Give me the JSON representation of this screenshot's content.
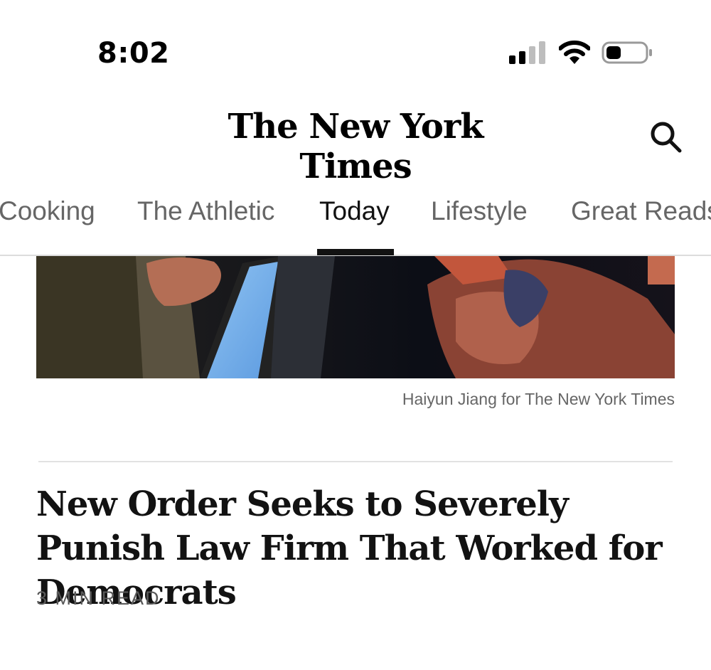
{
  "status_bar": {
    "time": "8:02"
  },
  "masthead": {
    "logo_text": "The New York Times"
  },
  "nav": {
    "tabs": [
      {
        "label": "Cooking",
        "active": false
      },
      {
        "label": "The Athletic",
        "active": false
      },
      {
        "label": "Today",
        "active": true
      },
      {
        "label": "Lifestyle",
        "active": false
      },
      {
        "label": "Great Reads",
        "active": false
      }
    ]
  },
  "article": {
    "photo_credit": "Haiyun Jiang for The New York Times",
    "headline": "New Order Seeks to Severely Punish Law Firm That Worked for Democrats",
    "read_time": "3 MIN READ"
  }
}
